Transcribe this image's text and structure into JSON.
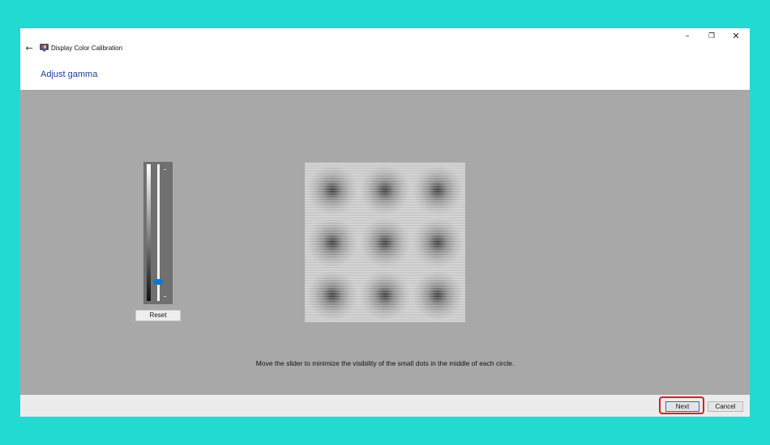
{
  "window": {
    "title": "Display Color Calibration",
    "controls": {
      "minimize": "–",
      "maximize": "❐",
      "close": "✕"
    },
    "back_icon": "←"
  },
  "page": {
    "heading": "Adjust gamma"
  },
  "gamma": {
    "slider_level": 0.14,
    "reset_label": "Reset",
    "instruction": "Move the slider to minimize the visibility of the small dots in the middle of each circle."
  },
  "footer": {
    "next_label": "Next",
    "cancel_label": "Cancel",
    "highlight_color": "#e01b24"
  },
  "colors": {
    "background": "#21dbd3",
    "heading": "#1d3f99",
    "content_gray": "#a8a8a8",
    "slider_thumb": "#0a78d7"
  },
  "icons": [
    "back-arrow-icon",
    "display-calibration-icon",
    "minimize-icon",
    "maximize-icon",
    "close-icon"
  ]
}
